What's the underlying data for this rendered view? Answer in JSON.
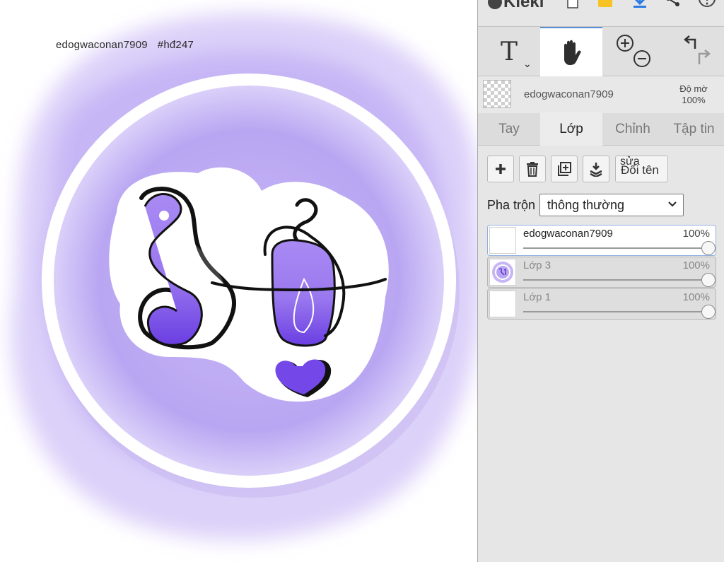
{
  "canvas": {
    "text_username": "edogwaconan7909",
    "text_tag": "#hđ247",
    "colors": {
      "wash": "#b9a6f2",
      "ring": "#ffffff",
      "glyph_fill": "#9d7cf0",
      "glyph_deep": "#7346e6",
      "outline": "#111111"
    }
  },
  "topbar": {
    "app_name": "Kleki"
  },
  "tools": {
    "text_glyph": "T",
    "caret": "⌄"
  },
  "layer_info": {
    "name": "edogwaconan7909",
    "opacity_label": "Độ mờ",
    "opacity_value": "100%"
  },
  "tabs": [
    {
      "label": "Tay"
    },
    {
      "label": "Lớp"
    },
    {
      "label": "Chỉnh"
    },
    {
      "label": "Tập tin"
    }
  ],
  "layer_actions": {
    "rename_line1": "sửa",
    "rename_line2": "Đổi tên"
  },
  "blend": {
    "label": "Pha trộn",
    "value": "thông thường"
  },
  "layers": [
    {
      "name": "edogwaconan7909",
      "opacity": "100%",
      "opacity_level": 1.0
    },
    {
      "name": "Lớp 3",
      "opacity": "100%",
      "opacity_level": 1.0
    },
    {
      "name": "Lớp 1",
      "opacity": "100%",
      "opacity_level": 1.0
    }
  ]
}
